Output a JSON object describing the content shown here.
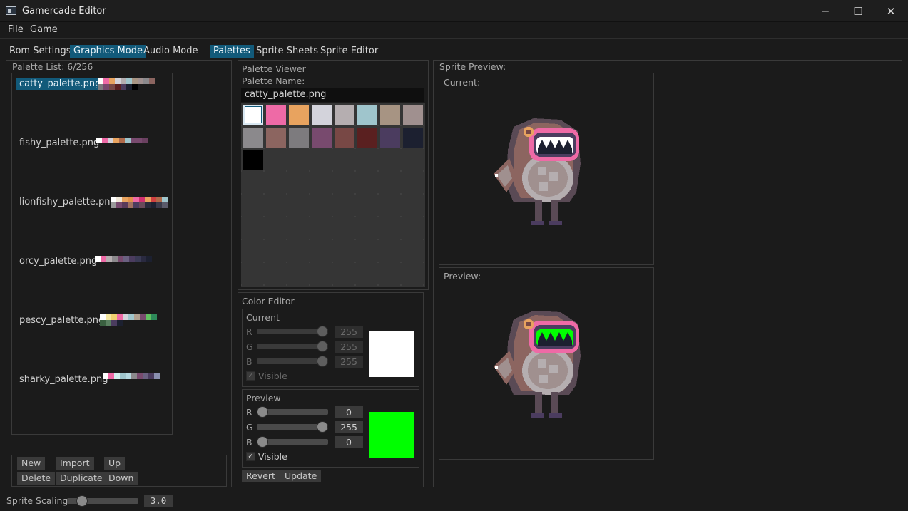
{
  "window": {
    "title": "Gamercade Editor",
    "minimize": "─",
    "maximize": "☐",
    "close": "✕"
  },
  "menu": {
    "file": "File",
    "game": "Game"
  },
  "mode_tabs": [
    "Rom Settings",
    "Graphics Mode",
    "Audio Mode"
  ],
  "sub_tabs": [
    "Palettes",
    "Sprite Sheets",
    "Sprite Editor"
  ],
  "palette_list": {
    "title": "Palette List: 6/256",
    "items": [
      {
        "name": "catty_palette.png",
        "colors": [
          "#ffffff",
          "#ee6aa6",
          "#e8a35f",
          "#d3d3db",
          "#b5aeb0",
          "#9fc5cc",
          "#a79483",
          "#a0908f",
          "#8b898c",
          "#8c6560",
          "#7d7b7e",
          "#784a6e",
          "#784845",
          "#5a2020",
          "#4b3c5f",
          "#1c2030",
          "#000000"
        ]
      },
      {
        "name": "fishy_palette.png",
        "colors": [
          "#ffffff",
          "#ee6aa6",
          "#d3d3db",
          "#e8a35f",
          "#b06a4a",
          "#9fc5cc",
          "#784a6e",
          "#784a6e",
          "#6a4060"
        ]
      },
      {
        "name": "lionfishy_palette.png",
        "colors": [
          "#ffffff",
          "#f0e8d8",
          "#e8a35f",
          "#e0904a",
          "#ee6aa6",
          "#d03070",
          "#e8a35f",
          "#d04040",
          "#b06a4a",
          "#9fc5cc",
          "#9a9a9a",
          "#784a6e",
          "#5a3a5a",
          "#a07060",
          "#4b3c5f",
          "#6a4a5a",
          "#2a2a3a",
          "#1c2030",
          "#3a3a4a",
          "#5a5a6a"
        ]
      },
      {
        "name": "orcy_palette.png",
        "colors": [
          "#ffffff",
          "#ee6aa6",
          "#b5aeb0",
          "#8b898c",
          "#784a6e",
          "#6a6080",
          "#4b3c5f",
          "#3a3a55",
          "#2a2a40",
          "#1c2030"
        ]
      },
      {
        "name": "pescy_palette.png",
        "colors": [
          "#ffffff",
          "#f6e8a0",
          "#f0d070",
          "#ee6aa6",
          "#d3d3db",
          "#9fc5cc",
          "#b0a090",
          "#784a6e",
          "#60c060",
          "#2e8a5a",
          "#3a6040",
          "#5a8060",
          "#4b3c5f",
          "#1c2030"
        ]
      },
      {
        "name": "sharky_palette.png",
        "colors": [
          "#ffffff",
          "#ee6aa6",
          "#d3f0f0",
          "#9fc5cc",
          "#b5d8e0",
          "#8b898c",
          "#784a6e",
          "#6a6080",
          "#4b3c5f",
          "#8a90b0"
        ]
      }
    ],
    "buttons": {
      "new": "New",
      "import": "Import",
      "up": "Up",
      "delete": "Delete",
      "duplicate": "Duplicate",
      "down": "Down"
    }
  },
  "palette_viewer": {
    "title": "Palette Viewer",
    "name_label": "Palette Name:",
    "name_value": "catty_palette.png",
    "swatches": [
      "#ffffff",
      "#ee6aa6",
      "#e8a35f",
      "#d3d3db",
      "#b5aeb0",
      "#9fc5cc",
      "#a79483",
      "#a0908f",
      "#8b898c",
      "#8c6560",
      "#7d7b7e",
      "#784a6e",
      "#784845",
      "#5a2020",
      "#4b3c5f",
      "#1c2030",
      "#000000"
    ]
  },
  "color_editor": {
    "title": "Color Editor",
    "current": {
      "title": "Current",
      "r_label": "R",
      "g_label": "G",
      "b_label": "B",
      "r": "255",
      "g": "255",
      "b": "255",
      "r_level": 1.0,
      "g_level": 1.0,
      "b_level": 1.0,
      "visible_label": "Visible",
      "color": "#ffffff"
    },
    "preview": {
      "title": "Preview",
      "r_label": "R",
      "g_label": "G",
      "b_label": "B",
      "r": "0",
      "g": "255",
      "b": "0",
      "r_level": 0.0,
      "g_level": 1.0,
      "b_level": 0.0,
      "visible_label": "Visible",
      "color": "#00ff00"
    },
    "revert": "Revert",
    "update": "Update",
    "check_mark": "✓"
  },
  "sprite_preview": {
    "title": "Sprite Preview:",
    "current_label": "Current:",
    "preview_label": "Preview:"
  },
  "status": {
    "scaling_label": "Sprite Scaling:",
    "scaling_value": "3.0",
    "scaling_level": 0.15
  },
  "colors": {
    "accent": "#125a7a",
    "background": "#1b1b1b",
    "panel_border": "#3a3a3a"
  }
}
